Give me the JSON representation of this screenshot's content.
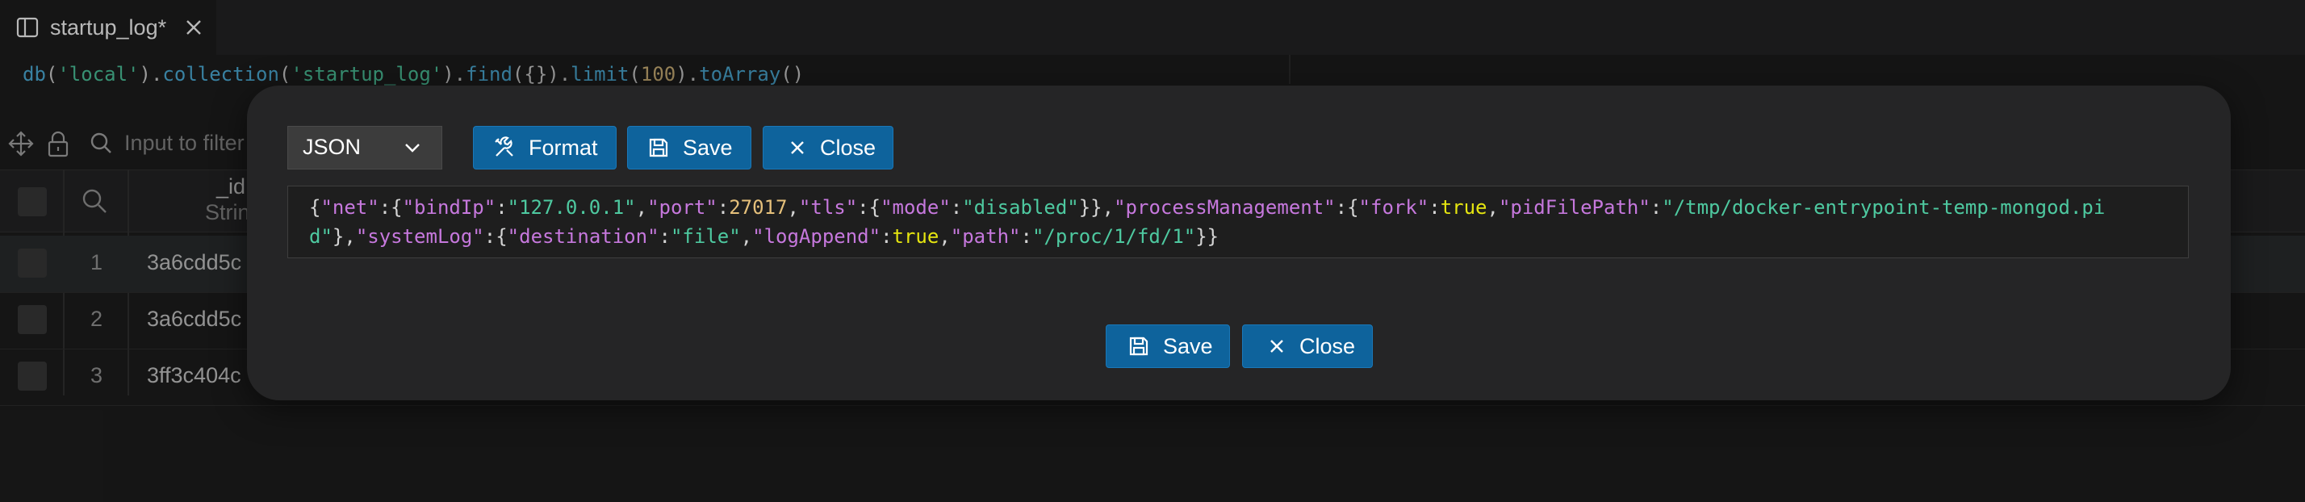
{
  "tab": {
    "label": "startup_log*",
    "icon": "split-panel-icon",
    "close_icon": "close-icon"
  },
  "query": {
    "fn1": "db",
    "p1": "(",
    "s1": "'local'",
    "p2": ").",
    "fn2": "collection",
    "p3": "(",
    "s2": "'startup_log'",
    "p4": ").",
    "fn3": "find",
    "p5": "({}).",
    "fn4": "limit",
    "p6": "(",
    "n1": "100",
    "p7": ").",
    "fn5": "toArray",
    "p8": "()"
  },
  "toolbar": {
    "filter_placeholder": "Input to filter"
  },
  "grid": {
    "column": {
      "name": "_id",
      "type": "String"
    },
    "rows": [
      {
        "num": "1",
        "id": "3a6cdd5c"
      },
      {
        "num": "2",
        "id": "3a6cdd5c"
      },
      {
        "num": "3",
        "id": "3ff3c404c"
      }
    ]
  },
  "modal": {
    "format_select": "JSON",
    "buttons": {
      "format": "Format",
      "save": "Save",
      "close": "Close"
    },
    "footer": {
      "save": "Save",
      "close": "Close"
    },
    "json_tokens": [
      [
        "p",
        "{"
      ],
      [
        "k",
        "\"net\""
      ],
      [
        "p",
        ":{"
      ],
      [
        "k",
        "\"bindIp\""
      ],
      [
        "p",
        ":"
      ],
      [
        "s",
        "\"127.0.0.1\""
      ],
      [
        "p",
        ","
      ],
      [
        "k",
        "\"port\""
      ],
      [
        "p",
        ":"
      ],
      [
        "n",
        "27017"
      ],
      [
        "p",
        ","
      ],
      [
        "k",
        "\"tls\""
      ],
      [
        "p",
        ":{"
      ],
      [
        "k",
        "\"mode\""
      ],
      [
        "p",
        ":"
      ],
      [
        "s",
        "\"disabled\""
      ],
      [
        "p",
        "}},"
      ],
      [
        "k",
        "\"processManagement\""
      ],
      [
        "p",
        ":{"
      ],
      [
        "k",
        "\"fork\""
      ],
      [
        "p",
        ":"
      ],
      [
        "b",
        "true"
      ],
      [
        "p",
        ","
      ],
      [
        "k",
        "\"pidFilePath\""
      ],
      [
        "p",
        ":"
      ],
      [
        "s",
        "\"/tmp/docker-entrypoint-temp-mongod.pid\""
      ],
      [
        "p",
        "},"
      ],
      [
        "k",
        "\"systemLog\""
      ],
      [
        "p",
        ":{"
      ],
      [
        "k",
        "\"destination\""
      ],
      [
        "p",
        ":"
      ],
      [
        "s",
        "\"file\""
      ],
      [
        "p",
        ","
      ],
      [
        "k",
        "\"logAppend\""
      ],
      [
        "p",
        ":"
      ],
      [
        "b",
        "true"
      ],
      [
        "p",
        ","
      ],
      [
        "k",
        "\"path\""
      ],
      [
        "p",
        ":"
      ],
      [
        "s",
        "\"/proc/1/fd/1\""
      ],
      [
        "p",
        "}}"
      ]
    ]
  },
  "colors": {
    "accent": "#0e639c",
    "key": "#c678dd",
    "string": "#4ec9a0",
    "number": "#e5c07b",
    "boolean": "#e5e510"
  }
}
